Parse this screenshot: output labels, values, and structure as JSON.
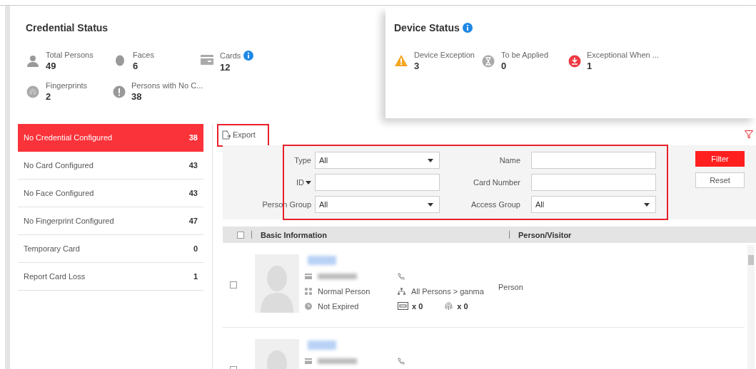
{
  "credential_status": {
    "title": "Credential Status",
    "stats": [
      {
        "kind": "person",
        "label": "Total Persons",
        "value": "49",
        "info": false
      },
      {
        "kind": "face",
        "label": "Faces",
        "value": "6",
        "info": false
      },
      {
        "kind": "card",
        "label": "Cards",
        "value": "12",
        "info": true
      },
      {
        "kind": "fingerprint",
        "label": "Fingerprints",
        "value": "2",
        "info": false
      },
      {
        "kind": "alert",
        "label": "Persons with No C...",
        "value": "38",
        "info": false
      }
    ]
  },
  "device_status": {
    "title": "Device Status",
    "info": true,
    "stats": [
      {
        "kind": "warning",
        "label": "Device Exception",
        "value": "3"
      },
      {
        "kind": "hourglass",
        "label": "To be Applied",
        "value": "0"
      },
      {
        "kind": "download",
        "label": "Exceptional When ...",
        "value": "1"
      }
    ]
  },
  "categories": [
    {
      "label": "No Credential Configured",
      "count": "38",
      "selected": true
    },
    {
      "label": "No Card Configured",
      "count": "43",
      "selected": false
    },
    {
      "label": "No Face Configured",
      "count": "43",
      "selected": false
    },
    {
      "label": "No Fingerprint Configured",
      "count": "47",
      "selected": false
    },
    {
      "label": "Temporary Card",
      "count": "0",
      "selected": false
    },
    {
      "label": "Report Card Loss",
      "count": "1",
      "selected": false
    }
  ],
  "toolbar": {
    "export": "Export"
  },
  "filter": {
    "fields": [
      {
        "label": "Type",
        "kind": "select",
        "value": "All",
        "label_menu": false
      },
      {
        "label": "Name",
        "kind": "input",
        "label_menu": false
      },
      {
        "label": "ID",
        "kind": "input",
        "label_menu": true
      },
      {
        "label": "Card Number",
        "kind": "input",
        "label_menu": false
      },
      {
        "label": "Person Group",
        "kind": "select",
        "value": "All",
        "label_menu": false
      },
      {
        "label": "Access Group",
        "kind": "select",
        "value": "All",
        "label_menu": false
      }
    ],
    "buttons": [
      {
        "label": "Filter",
        "kind": "primary"
      },
      {
        "label": "Reset",
        "kind": "secondary"
      }
    ]
  },
  "table": {
    "header_checked": false,
    "columns": [
      "Basic Information",
      "Person/Visitor"
    ],
    "rows": [
      {
        "checked": false,
        "person_type": "Normal Person",
        "group": "All Persons > ganma",
        "validity": "Not Expired",
        "cards": "x 0",
        "fingerprints": "x 0",
        "person_visitor": "Person"
      },
      {
        "checked": false
      }
    ]
  }
}
